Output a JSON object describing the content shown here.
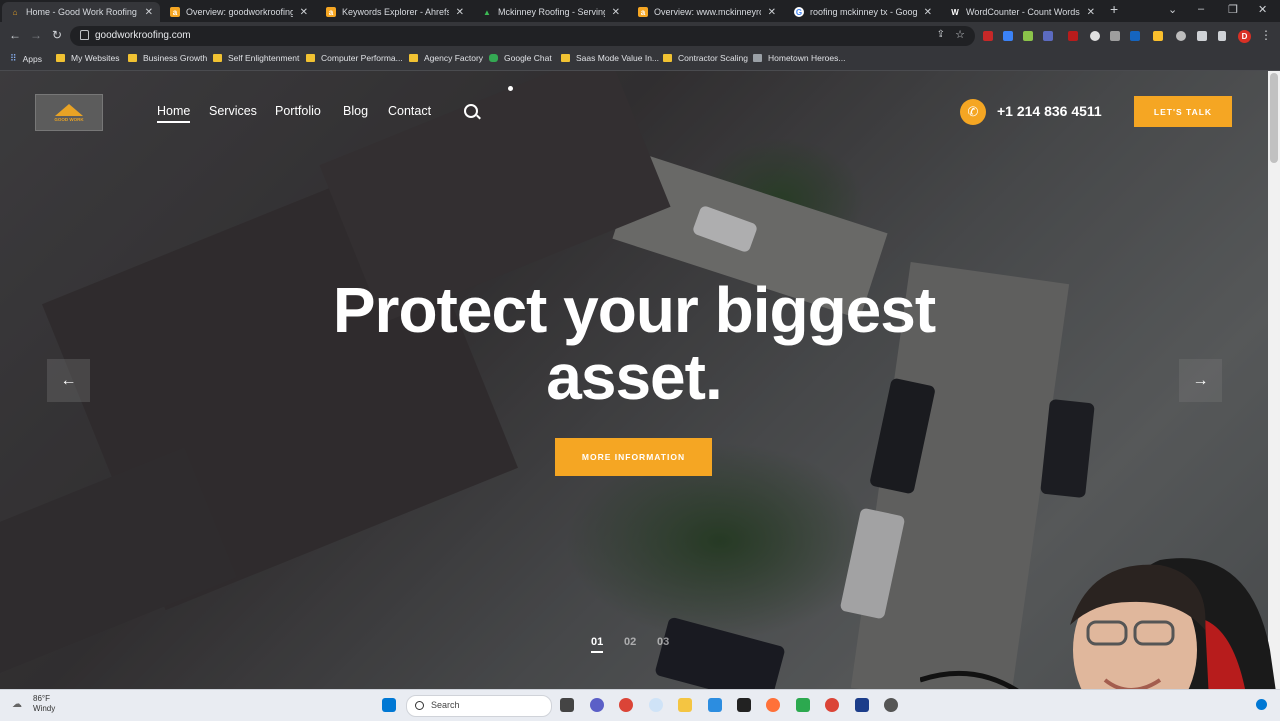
{
  "browser": {
    "tabs": [
      {
        "title": "Home - Good Work Roofing",
        "icon": "roofing-favicon",
        "active": true
      },
      {
        "title": "Overview: goodworkroofing.com",
        "icon": "ahrefs-favicon"
      },
      {
        "title": "Keywords Explorer - Ahrefs",
        "icon": "ahrefs-favicon"
      },
      {
        "title": "Mckinney Roofing - Serving All",
        "icon": "roofing-favicon"
      },
      {
        "title": "Overview: www.mckinneyroofing",
        "icon": "ahrefs-favicon"
      },
      {
        "title": "roofing mckinney tx - Google S",
        "icon": "google-favicon"
      },
      {
        "title": "WordCounter - Count Words &",
        "icon": "wordcounter-favicon"
      }
    ],
    "url": "goodworkroofing.com",
    "profile_initial": "D",
    "bookmarks": [
      "Apps",
      "My Websites",
      "Business Growth",
      "Self Enlightenment",
      "Computer Performa...",
      "Agency Factory",
      "Google Chat",
      "Saas Mode Value In...",
      "Contractor Scaling",
      "Hometown Heroes..."
    ]
  },
  "site": {
    "logo_text": "GOOD WORK",
    "nav": [
      "Home",
      "Services",
      "Portfolio",
      "Blog",
      "Contact"
    ],
    "phone": "+1 214 836 4511",
    "cta": "LET'S TALK",
    "headline_line1": "Protect your biggest",
    "headline_line2": "asset.",
    "more_button": "MORE INFORMATION",
    "slides": [
      "01",
      "02",
      "03"
    ]
  },
  "taskbar": {
    "weather_temp": "86°F",
    "weather_desc": "Windy",
    "search_placeholder": "Search"
  },
  "colors": {
    "accent": "#f5a623"
  }
}
